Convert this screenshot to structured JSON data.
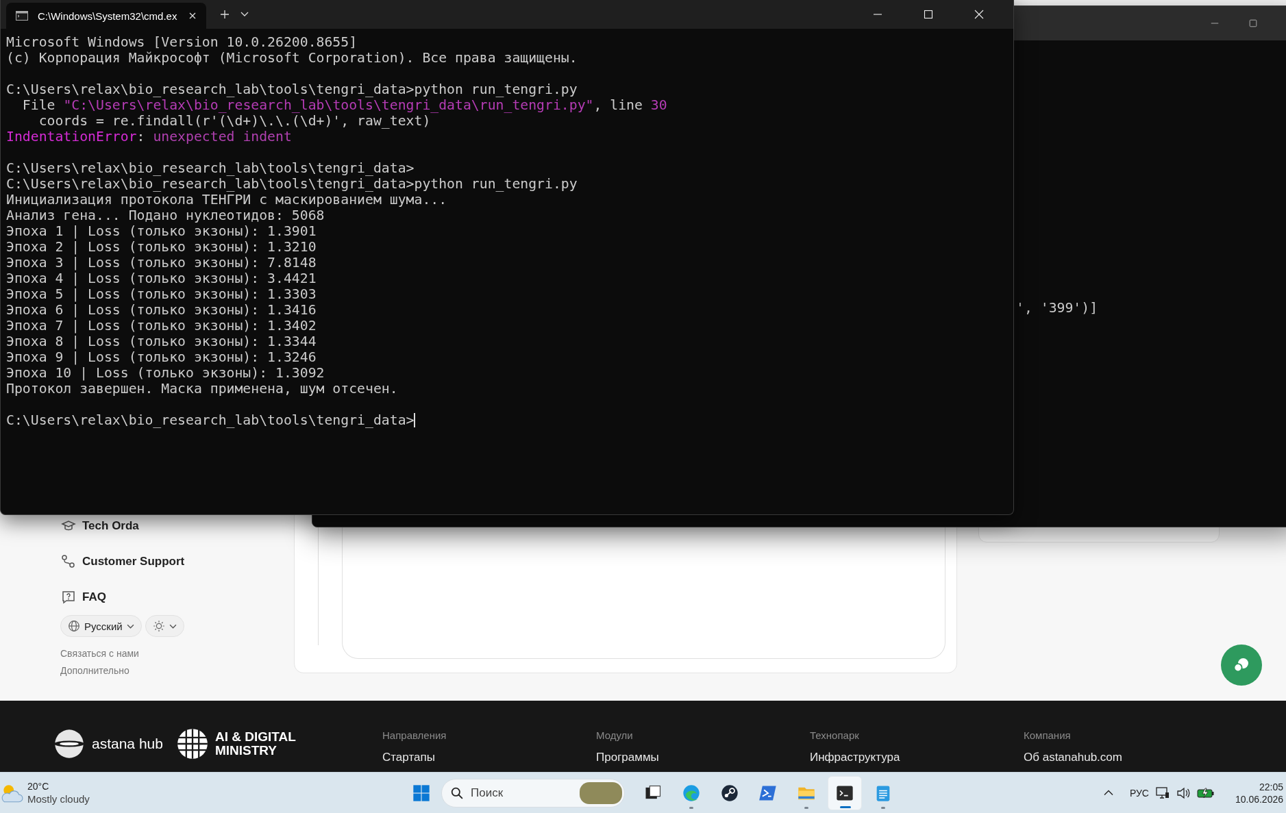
{
  "terminal": {
    "tab": {
      "title": "C:\\Windows\\System32\\cmd.ex",
      "selected": true
    },
    "lines": [
      {
        "kind": "text",
        "segments": [
          {
            "text": "Microsoft Windows [Version 10.0.26200.8655]",
            "color": "#cccccc"
          }
        ]
      },
      {
        "kind": "text",
        "segments": [
          {
            "text": "(c) Корпорация Майкрософт (Microsoft Corporation). Все права защищены.",
            "color": "#cccccc"
          }
        ]
      },
      {
        "kind": "blank"
      },
      {
        "kind": "text",
        "segments": [
          {
            "text": "C:\\Users\\relax\\bio_research_lab\\tools\\tengri_data>python run_tengri.py",
            "color": "#cccccc"
          }
        ]
      },
      {
        "kind": "text",
        "segments": [
          {
            "text": "  File ",
            "color": "#cccccc"
          },
          {
            "text": "\"C:\\Users\\relax\\bio_research_lab\\tools\\tengri_data\\run_tengri.py\"",
            "color": "#b53cb5"
          },
          {
            "text": ", line ",
            "color": "#cccccc"
          },
          {
            "text": "30",
            "color": "#b53cb5"
          }
        ]
      },
      {
        "kind": "text",
        "segments": [
          {
            "text": "    coords = re.findall(r'(\\d+)\\.\\.(\\d+)', raw_text)",
            "color": "#cccccc"
          }
        ]
      },
      {
        "kind": "text",
        "segments": [
          {
            "text": "IndentationError",
            "color": "#d42bd4"
          },
          {
            "text": ": ",
            "color": "#cccccc"
          },
          {
            "text": "unexpected indent",
            "color": "#b040b0"
          }
        ]
      },
      {
        "kind": "blank"
      },
      {
        "kind": "text",
        "segments": [
          {
            "text": "C:\\Users\\relax\\bio_research_lab\\tools\\tengri_data>",
            "color": "#cccccc"
          }
        ]
      },
      {
        "kind": "text",
        "segments": [
          {
            "text": "C:\\Users\\relax\\bio_research_lab\\tools\\tengri_data>python run_tengri.py",
            "color": "#cccccc"
          }
        ]
      },
      {
        "kind": "text",
        "segments": [
          {
            "text": "Инициализация протокола ТЕНГРИ с маскированием шума...",
            "color": "#cccccc"
          }
        ]
      },
      {
        "kind": "text",
        "segments": [
          {
            "text": "Анализ гена... Подано нуклеотидов: 5068",
            "color": "#cccccc"
          }
        ]
      },
      {
        "kind": "text",
        "segments": [
          {
            "text": "Эпоха 1 | Loss (только экзоны): 1.3901",
            "color": "#cccccc"
          }
        ]
      },
      {
        "kind": "text",
        "segments": [
          {
            "text": "Эпоха 2 | Loss (только экзоны): 1.3210",
            "color": "#cccccc"
          }
        ]
      },
      {
        "kind": "text",
        "segments": [
          {
            "text": "Эпоха 3 | Loss (только экзоны): 7.8148",
            "color": "#cccccc"
          }
        ]
      },
      {
        "kind": "text",
        "segments": [
          {
            "text": "Эпоха 4 | Loss (только экзоны): 3.4421",
            "color": "#cccccc"
          }
        ]
      },
      {
        "kind": "text",
        "segments": [
          {
            "text": "Эпоха 5 | Loss (только экзоны): 1.3303",
            "color": "#cccccc"
          }
        ]
      },
      {
        "kind": "text",
        "segments": [
          {
            "text": "Эпоха 6 | Loss (только экзоны): 1.3416",
            "color": "#cccccc"
          }
        ]
      },
      {
        "kind": "text",
        "segments": [
          {
            "text": "Эпоха 7 | Loss (только экзоны): 1.3402",
            "color": "#cccccc"
          }
        ]
      },
      {
        "kind": "text",
        "segments": [
          {
            "text": "Эпоха 8 | Loss (только экзоны): 1.3344",
            "color": "#cccccc"
          }
        ]
      },
      {
        "kind": "text",
        "segments": [
          {
            "text": "Эпоха 9 | Loss (только экзоны): 1.3246",
            "color": "#cccccc"
          }
        ]
      },
      {
        "kind": "text",
        "segments": [
          {
            "text": "Эпоха 10 | Loss (только экзоны): 1.3092",
            "color": "#cccccc"
          }
        ]
      },
      {
        "kind": "text",
        "segments": [
          {
            "text": "Протокол завершен. Маска применена, шум отсечен.",
            "color": "#cccccc"
          }
        ]
      },
      {
        "kind": "blank"
      },
      {
        "kind": "text",
        "cursor": true,
        "segments": [
          {
            "text": "C:\\Users\\relax\\bio_research_lab\\tools\\tengri_data>",
            "color": "#cccccc"
          }
        ]
      }
    ]
  },
  "background_terminal": {
    "visible_text": "', '399')]"
  },
  "webpage": {
    "sidebar": {
      "items": [
        {
          "label": "Tech Orda"
        },
        {
          "label": "Customer Support"
        },
        {
          "label": "FAQ"
        }
      ],
      "language": {
        "label": "Русский"
      },
      "links": [
        "Связаться с нами",
        "Дополнительно"
      ]
    },
    "footer": {
      "logos": {
        "hub": "astana hub",
        "ministry": [
          "AI & DIGITAL",
          "MINISTRY"
        ]
      },
      "columns": [
        {
          "heading": "Направления",
          "link": "Стартапы"
        },
        {
          "heading": "Модули",
          "link": "Программы"
        },
        {
          "heading": "Технопарк",
          "link": "Инфраструктура"
        },
        {
          "heading": "Компания",
          "link": "Об astanahub.com"
        }
      ]
    }
  },
  "taskbar": {
    "weather": {
      "temperature": "20°C",
      "condition": "Mostly cloudy"
    },
    "search": {
      "placeholder": "Поиск"
    },
    "apps": [
      {
        "running": false,
        "selected": false
      },
      {
        "running": true,
        "selected": false
      },
      {
        "running": false,
        "selected": false
      },
      {
        "running": false,
        "selected": false
      },
      {
        "running": true,
        "selected": false
      },
      {
        "running": true,
        "selected": true
      },
      {
        "running": true,
        "selected": false
      }
    ],
    "language": "РУС",
    "time": "22:05",
    "date": "10.06.2026"
  }
}
